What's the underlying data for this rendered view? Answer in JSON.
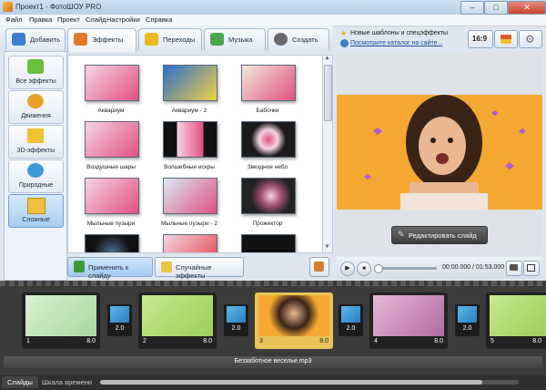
{
  "window": {
    "title": "Проект1 - ФотоШОУ PRO",
    "min": "–",
    "max": "□",
    "close": "✕"
  },
  "menu": [
    "Файл",
    "Правка",
    "Проект",
    "Слайд",
    "Настройки",
    "Справка"
  ],
  "tabs": [
    {
      "label": "Добавить",
      "icon": "add-files-icon",
      "color": "#3a7fc8"
    },
    {
      "label": "Эффекты",
      "icon": "effects-brush-icon",
      "color": "#e07a2a",
      "active": true
    },
    {
      "label": "Переходы",
      "icon": "transitions-star-icon",
      "color": "#f0b820"
    },
    {
      "label": "Музыка",
      "icon": "music-note-icon",
      "color": "#4aa84a"
    },
    {
      "label": "Создать",
      "icon": "create-disc-icon",
      "color": "#6a6a6a"
    }
  ],
  "categories": [
    {
      "label": "Все эффекты",
      "icon": "puzzle-icon",
      "color": "#6abf3c"
    },
    {
      "label": "Движения",
      "icon": "move-arrows-icon",
      "color": "#e9a22a"
    },
    {
      "label": "3D-эффекты",
      "icon": "cube-icon",
      "color": "#f1c232"
    },
    {
      "label": "Природные",
      "icon": "snowflake-icon",
      "color": "#3a9ad9"
    },
    {
      "label": "Сложные",
      "icon": "layers-icon",
      "color": "#f0c040",
      "selected": true
    }
  ],
  "effects": [
    {
      "label": "Аквариум",
      "bg": "#f6d3e3"
    },
    {
      "label": "Аквариум - 2",
      "bg": "#2e6fd0"
    },
    {
      "label": "Бабочки",
      "bg": "#f2e9d9"
    },
    {
      "label": "Воздушные шары",
      "bg": "#f6d3e3"
    },
    {
      "label": "Волшебные искры",
      "bg": "#111111"
    },
    {
      "label": "Звездное небо",
      "bg": "#1a1a1a"
    },
    {
      "label": "Мыльные пузыри",
      "bg": "#f6d3e3"
    },
    {
      "label": "Мыльные пузыри - 2",
      "bg": "#dbe8f5"
    },
    {
      "label": "Прожектор",
      "bg": "#222222"
    },
    {
      "label": "",
      "bg": "#111111"
    },
    {
      "label": "",
      "bg": "#e04040"
    },
    {
      "label": "",
      "bg": "#111111"
    }
  ],
  "actions": {
    "apply": "Применить к слайду",
    "random": "Случайные эффекты"
  },
  "news": {
    "line1": "Новые шаблоны и спецэффекты",
    "line2": "Посмотрите каталог на сайте..."
  },
  "aspect": "16:9",
  "edit_slide": "Редактировать слайд",
  "player": {
    "time": "00:00.000 / 01:53.000",
    "progress": 0.05
  },
  "slides": [
    {
      "num": "1",
      "dur": "8.0",
      "color": "#a8d8a0"
    },
    {
      "num": "2",
      "dur": "8.0",
      "color": "#9ccf58"
    },
    {
      "num": "3",
      "dur": "8.0",
      "color": "#e9c44a",
      "selected": true
    },
    {
      "num": "4",
      "dur": "8.0",
      "color": "#b06a9c"
    },
    {
      "num": "5",
      "dur": "8.0",
      "color": "#9ccf58"
    }
  ],
  "transitions": [
    "2.0",
    "2.0",
    "2.0",
    "2.0"
  ],
  "audio": "Беззаботное веселье.mp3",
  "bottom_tabs": [
    "Слайды",
    "Шкала времени"
  ],
  "colors": {
    "accent": "#3a7fc8",
    "timeline": "#3b3b3b",
    "preview_bg": "#f4a832"
  }
}
